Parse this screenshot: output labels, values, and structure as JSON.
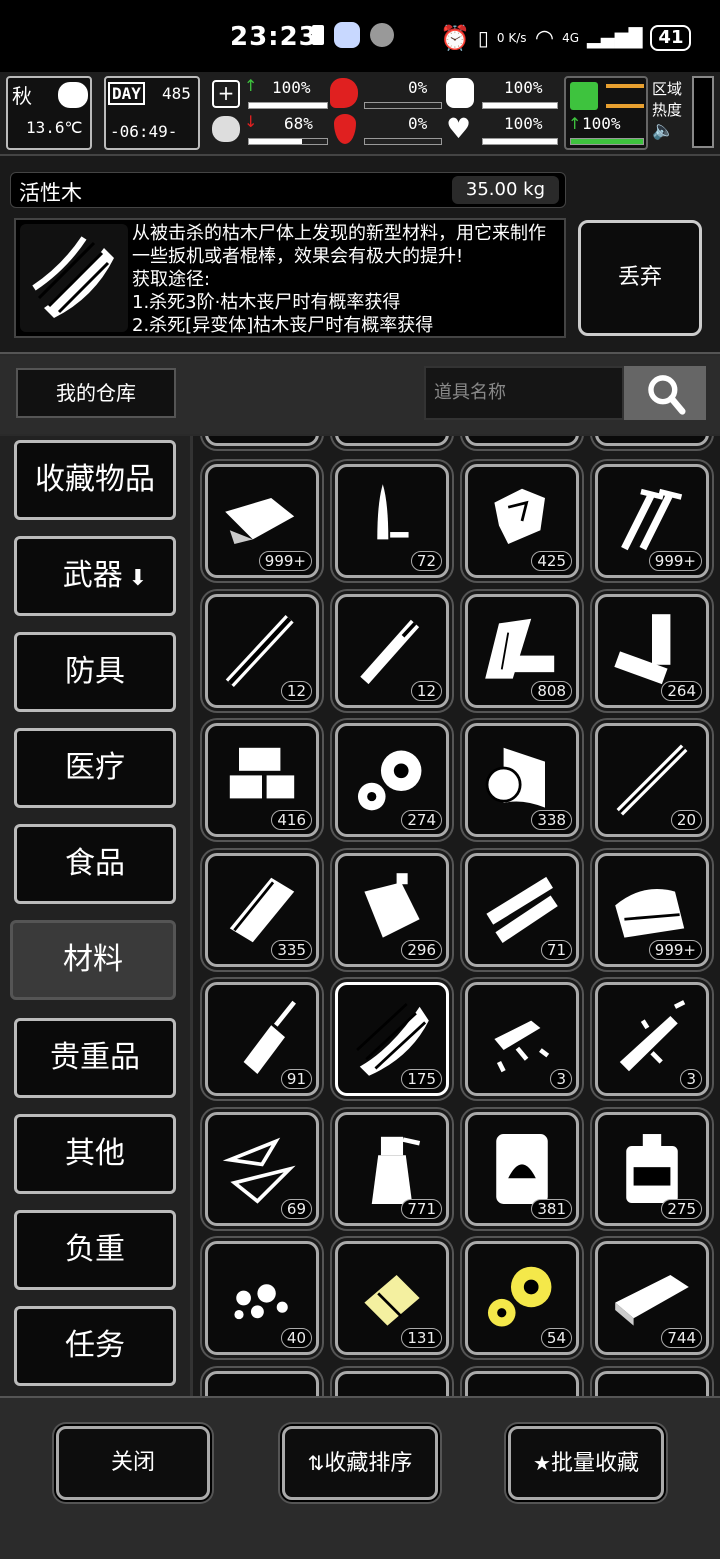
{
  "status_bar": {
    "time": "23:23",
    "net_speed": "0 K/s",
    "network": "4G",
    "battery": "41"
  },
  "hud": {
    "season": "秋",
    "temperature": "13.6℃",
    "day_label": "DAY",
    "day_number": "485",
    "clock": "-06:49-",
    "stats": [
      {
        "name": "health",
        "value": "100%",
        "fill": 1.0
      },
      {
        "name": "brain",
        "value": "68%",
        "fill": 0.68
      },
      {
        "name": "stomach",
        "value": "0%",
        "fill": 0.0
      },
      {
        "name": "blood",
        "value": "0%",
        "fill": 0.0
      },
      {
        "name": "armor",
        "value": "100%",
        "fill": 1.0
      },
      {
        "name": "heart",
        "value": "100%",
        "fill": 1.0
      },
      {
        "name": "stamina",
        "value": "100%",
        "fill": 1.0
      }
    ],
    "zone_label_1": "区域",
    "zone_label_2": "热度"
  },
  "item": {
    "name": "活性木",
    "weight": "35.00 kg",
    "description": "从被击杀的枯木尸体上发现的新型材料，用它来制作一些扳机或者棍棒，效果会有极大的提升!\n获取途径:\n1.杀死3阶·枯木丧尸时有概率获得\n2.杀死[异变体]枯木丧尸时有概率获得",
    "drop_label": "丢弃"
  },
  "warehouse_label": "我的仓库",
  "search": {
    "placeholder": "道具名称"
  },
  "categories": [
    {
      "label": "收藏物品"
    },
    {
      "label": "武器",
      "arrow": "⬇"
    },
    {
      "label": "防具"
    },
    {
      "label": "医疗"
    },
    {
      "label": "食品"
    },
    {
      "label": "材料"
    },
    {
      "label": "贵重品"
    },
    {
      "label": "其他"
    },
    {
      "label": "负重"
    },
    {
      "label": "任务"
    }
  ],
  "active_category": "材料",
  "items": [
    {
      "icon": "cloth-icon",
      "count": "999+"
    },
    {
      "icon": "bullet-icon",
      "count": "72"
    },
    {
      "icon": "rock-icon",
      "count": "425"
    },
    {
      "icon": "nails-icon",
      "count": "999+"
    },
    {
      "icon": "pipe-icon",
      "count": "12"
    },
    {
      "icon": "tube-icon",
      "count": "12"
    },
    {
      "icon": "planks-icon",
      "count": "808"
    },
    {
      "icon": "battery-icon",
      "count": "264"
    },
    {
      "icon": "bricks-icon",
      "count": "416"
    },
    {
      "icon": "gears-icon",
      "count": "274"
    },
    {
      "icon": "paper-roll-icon",
      "count": "338"
    },
    {
      "icon": "stick-icon",
      "count": "20"
    },
    {
      "icon": "log-icon",
      "count": "335"
    },
    {
      "icon": "jerrycan-icon",
      "count": "296"
    },
    {
      "icon": "pipes-icon",
      "count": "71"
    },
    {
      "icon": "fabric-icon",
      "count": "999+"
    },
    {
      "icon": "glue-icon",
      "count": "91"
    },
    {
      "icon": "active-wood-icon",
      "count": "175",
      "selected": true
    },
    {
      "icon": "rifle-parts-icon",
      "count": "3"
    },
    {
      "icon": "rifle-parts-2-icon",
      "count": "3"
    },
    {
      "icon": "glass-shards-icon",
      "count": "69"
    },
    {
      "icon": "spray-bottle-icon",
      "count": "771"
    },
    {
      "icon": "oil-barrel-icon",
      "count": "381"
    },
    {
      "icon": "chemical-can-icon",
      "count": "275"
    },
    {
      "icon": "debris-icon",
      "count": "40"
    },
    {
      "icon": "yellow-part-icon",
      "count": "131"
    },
    {
      "icon": "yellow-gears-icon",
      "count": "54"
    },
    {
      "icon": "metal-plate-icon",
      "count": "744"
    }
  ],
  "buttons": {
    "close": "关闭",
    "sort": "收藏排序",
    "batch": "批量收藏"
  }
}
